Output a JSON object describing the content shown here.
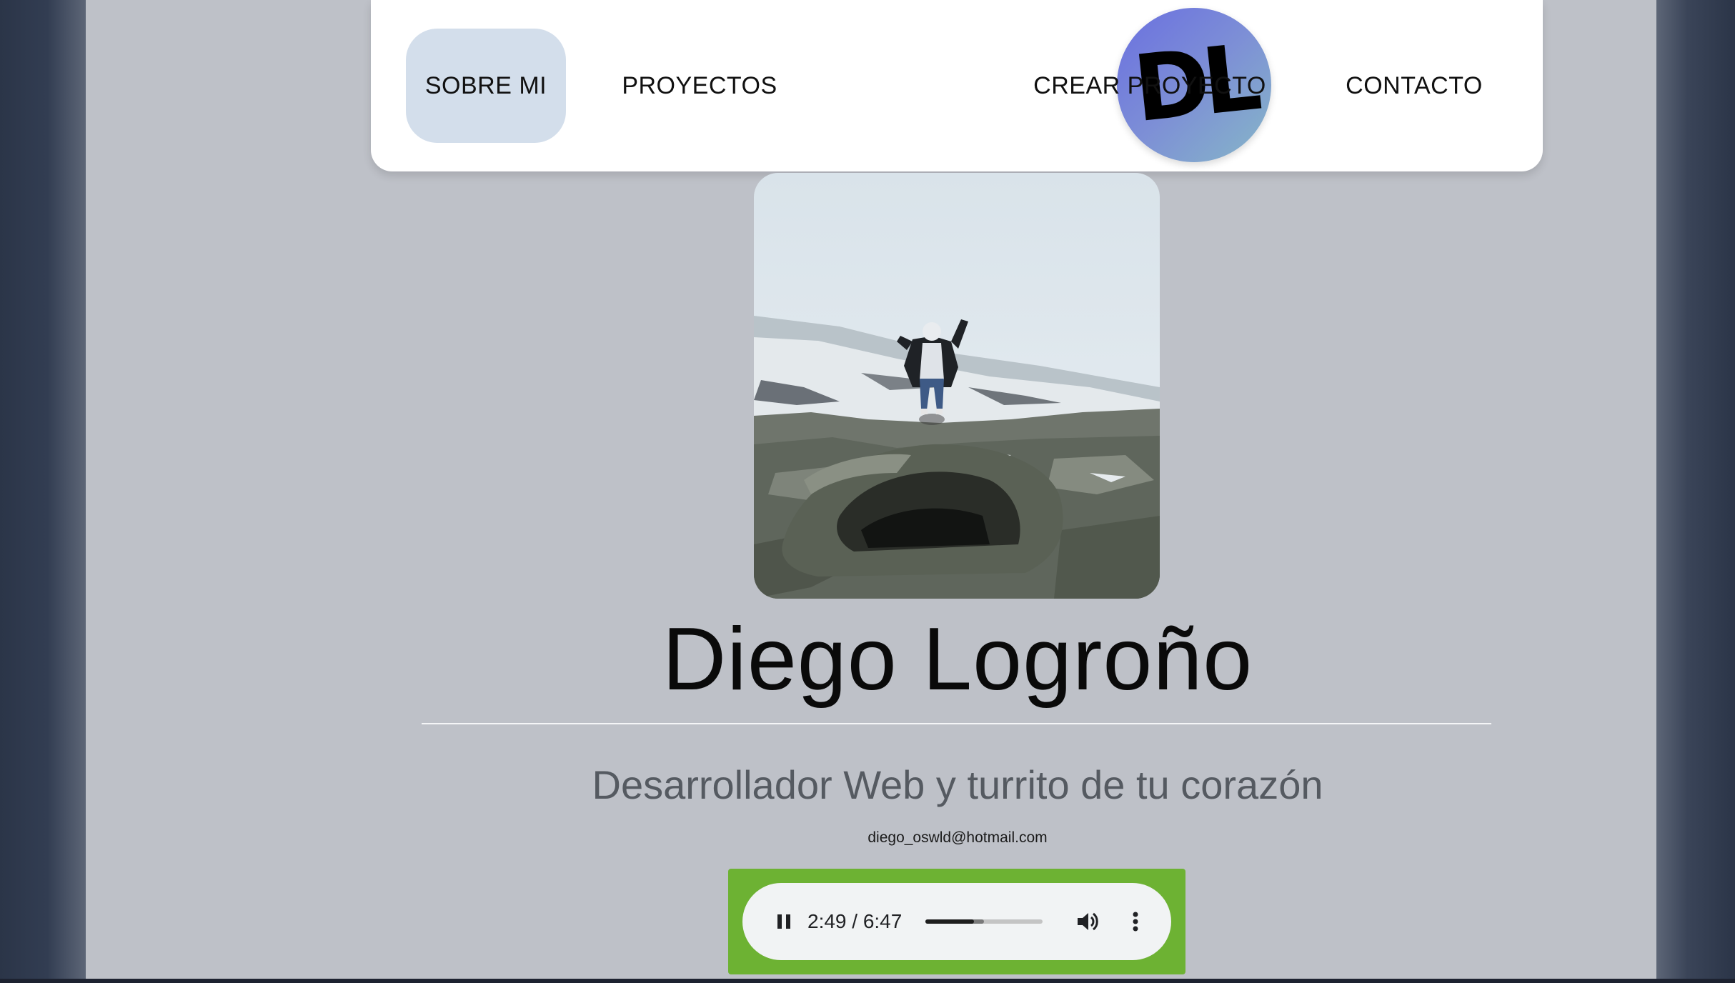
{
  "nav": {
    "items": [
      {
        "label": "SOBRE MI",
        "active": true
      },
      {
        "label": "PROYECTOS",
        "active": false
      },
      {
        "label": "CREAR PROYECTO",
        "active": false
      },
      {
        "label": "CONTACTO",
        "active": false
      }
    ],
    "logo_text": "DL"
  },
  "profile": {
    "name": "Diego Logroño",
    "subtitle": "Desarrollador Web y turrito de tu corazón",
    "email": "diego_oswld@hotmail.com"
  },
  "audio": {
    "time": "2:49 / 6:47",
    "progress_fraction": 0.415,
    "buffered_fraction": 0.5,
    "state": "playing",
    "icons": [
      "pause-icon",
      "volume-icon",
      "more-vert-icon"
    ]
  },
  "colors": {
    "page_bg": "#bec1c8",
    "frame_bg": "#2b3548",
    "nav_active_bg": "#d3deeb",
    "player_frame": "#6db233"
  }
}
